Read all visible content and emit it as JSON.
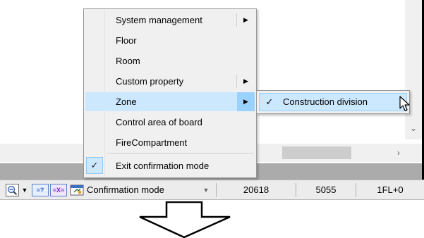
{
  "context_menu": {
    "items": [
      {
        "label": "System management",
        "has_submenu": true
      },
      {
        "label": "Floor",
        "has_submenu": false
      },
      {
        "label": "Room",
        "has_submenu": false
      },
      {
        "label": "Custom property",
        "has_submenu": true
      },
      {
        "label": "Zone",
        "has_submenu": true,
        "highlighted": true
      },
      {
        "label": "Control area of board",
        "has_submenu": false
      },
      {
        "label": "FireCompartment",
        "has_submenu": false
      }
    ],
    "exit_item": {
      "label": "Exit confirmation mode",
      "checked": true
    },
    "submenu_arrow": "▶"
  },
  "submenu": {
    "items": [
      {
        "label": "Construction division",
        "checked": true
      }
    ]
  },
  "status_bar": {
    "zoom_icon": "zoom-out-icon",
    "dropdown_glyph": "▼",
    "q_button": "=?",
    "x_button": "=X=",
    "mode": {
      "label": "Confirmation mode",
      "caret": "▼"
    },
    "fields": [
      "20618",
      "5055",
      "1FL+0"
    ]
  },
  "scrollbars": {
    "down_arrow": "⌄",
    "right_arrow": "›"
  },
  "glyphs": {
    "check": "✓"
  },
  "colors": {
    "menu_bg": "#f0f0f0",
    "highlight": "#cce8ff",
    "highlight_arrow": "#99d1ff",
    "gray_band": "#ababab"
  }
}
